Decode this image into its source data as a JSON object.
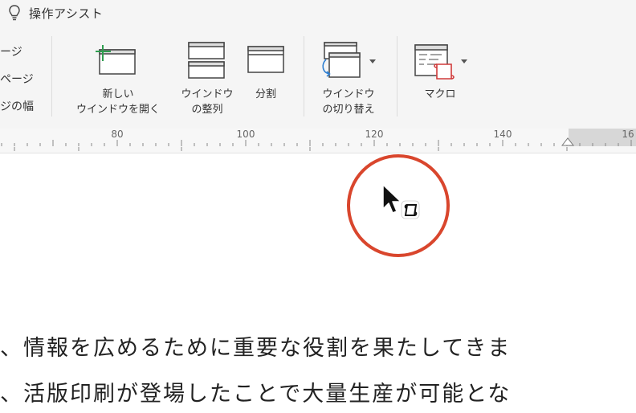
{
  "tell_me": {
    "label": "操作アシスト",
    "icon": "lightbulb-icon"
  },
  "left_items": [
    "ージ",
    "ページ",
    "ジの幅"
  ],
  "ribbon_buttons": {
    "new_window": {
      "line1": "新しい",
      "line2": "ウインドウを開く",
      "icon": "new-window-icon"
    },
    "arrange_windows": {
      "line1": "ウインドウ",
      "line2": "の整列",
      "icon": "arrange-windows-icon"
    },
    "split": {
      "line1": "分割",
      "icon": "split-icon"
    },
    "switch_windows": {
      "line1": "ウインドウ",
      "line2": "の切り替え",
      "icon": "switch-windows-icon"
    },
    "macro": {
      "line1": "マクロ",
      "icon": "macro-icon"
    }
  },
  "ruler": {
    "labels": [
      "80",
      "100",
      "120",
      "140",
      "16"
    ]
  },
  "document": {
    "lines": [
      "、情報を広めるために重要な役割を果たしてきま",
      "、活版印刷が登場したことで大量生産が可能とな"
    ]
  },
  "colors": {
    "accent_ring": "#d9462d",
    "new_window_plus": "#2e9e4f",
    "macro_red": "#d03a3a",
    "switch_blue": "#2f7fd1"
  }
}
